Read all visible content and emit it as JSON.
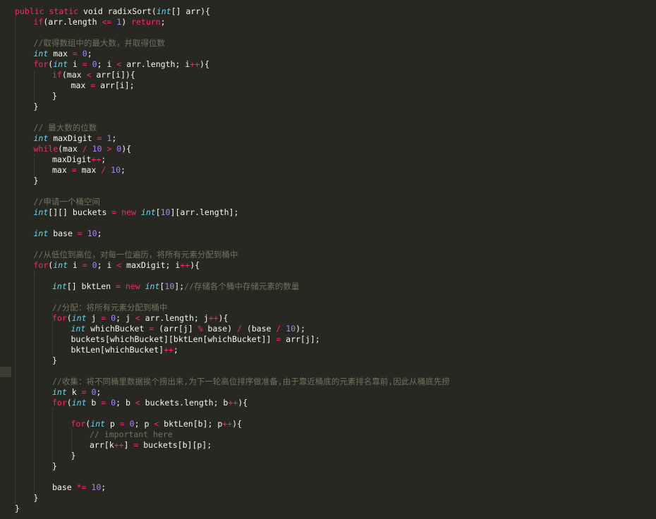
{
  "editor": {
    "lines": [
      {
        "i": 0,
        "t": [
          [
            "kw",
            "public"
          ],
          [
            "pl",
            " "
          ],
          [
            "kw",
            "static"
          ],
          [
            "pl",
            " void radixSort("
          ],
          [
            "type",
            "int"
          ],
          [
            "pl",
            "[] arr){"
          ]
        ]
      },
      {
        "i": 1,
        "t": [
          [
            "kw",
            "if"
          ],
          [
            "pl",
            "(arr.length "
          ],
          [
            "op",
            "<="
          ],
          [
            "pl",
            " "
          ],
          [
            "num",
            "1"
          ],
          [
            "pl",
            ") "
          ],
          [
            "kw",
            "return"
          ],
          [
            "pl",
            ";"
          ]
        ]
      },
      {
        "i": 0,
        "t": []
      },
      {
        "i": 1,
        "t": [
          [
            "com",
            "//取得数组中的最大数，并取得位数"
          ]
        ]
      },
      {
        "i": 1,
        "t": [
          [
            "type",
            "int"
          ],
          [
            "pl",
            " max "
          ],
          [
            "op",
            "="
          ],
          [
            "pl",
            " "
          ],
          [
            "num",
            "0"
          ],
          [
            "pl",
            ";"
          ]
        ]
      },
      {
        "i": 1,
        "t": [
          [
            "kw",
            "for"
          ],
          [
            "pl",
            "("
          ],
          [
            "type",
            "int"
          ],
          [
            "pl",
            " i "
          ],
          [
            "op",
            "="
          ],
          [
            "pl",
            " "
          ],
          [
            "num",
            "0"
          ],
          [
            "pl",
            "; i "
          ],
          [
            "op",
            "<"
          ],
          [
            "pl",
            " arr.length; i"
          ],
          [
            "op",
            "++"
          ],
          [
            "pl",
            "){"
          ]
        ]
      },
      {
        "i": 2,
        "t": [
          [
            "kw",
            "if"
          ],
          [
            "pl",
            "(max "
          ],
          [
            "op",
            "<"
          ],
          [
            "pl",
            " arr[i]){"
          ]
        ]
      },
      {
        "i": 3,
        "t": [
          [
            "pl",
            "max "
          ],
          [
            "op",
            "="
          ],
          [
            "pl",
            " arr[i];"
          ]
        ]
      },
      {
        "i": 2,
        "t": [
          [
            "pl",
            "}"
          ]
        ]
      },
      {
        "i": 1,
        "t": [
          [
            "pl",
            "}"
          ]
        ]
      },
      {
        "i": 0,
        "t": []
      },
      {
        "i": 1,
        "t": [
          [
            "com",
            "// 最大数的位数"
          ]
        ]
      },
      {
        "i": 1,
        "t": [
          [
            "type",
            "int"
          ],
          [
            "pl",
            " maxDigit "
          ],
          [
            "op",
            "="
          ],
          [
            "pl",
            " "
          ],
          [
            "num",
            "1"
          ],
          [
            "pl",
            ";"
          ]
        ]
      },
      {
        "i": 1,
        "t": [
          [
            "kw",
            "while"
          ],
          [
            "pl",
            "(max "
          ],
          [
            "op",
            "/"
          ],
          [
            "pl",
            " "
          ],
          [
            "num",
            "10"
          ],
          [
            "pl",
            " "
          ],
          [
            "op",
            ">"
          ],
          [
            "pl",
            " "
          ],
          [
            "num",
            "0"
          ],
          [
            "pl",
            "){"
          ]
        ]
      },
      {
        "i": 2,
        "t": [
          [
            "pl",
            "maxDigit"
          ],
          [
            "op",
            "++"
          ],
          [
            "pl",
            ";"
          ]
        ]
      },
      {
        "i": 2,
        "t": [
          [
            "pl",
            "max "
          ],
          [
            "op",
            "="
          ],
          [
            "pl",
            " max "
          ],
          [
            "op",
            "/"
          ],
          [
            "pl",
            " "
          ],
          [
            "num",
            "10"
          ],
          [
            "pl",
            ";"
          ]
        ]
      },
      {
        "i": 1,
        "t": [
          [
            "pl",
            "}"
          ]
        ]
      },
      {
        "i": 0,
        "t": []
      },
      {
        "i": 1,
        "t": [
          [
            "com",
            "//申请一个桶空间"
          ]
        ]
      },
      {
        "i": 1,
        "t": [
          [
            "type",
            "int"
          ],
          [
            "pl",
            "[][] buckets "
          ],
          [
            "op",
            "="
          ],
          [
            "pl",
            " "
          ],
          [
            "kw",
            "new"
          ],
          [
            "pl",
            " "
          ],
          [
            "type",
            "int"
          ],
          [
            "pl",
            "["
          ],
          [
            "num",
            "10"
          ],
          [
            "pl",
            "][arr.length];"
          ]
        ]
      },
      {
        "i": 0,
        "t": []
      },
      {
        "i": 1,
        "t": [
          [
            "type",
            "int"
          ],
          [
            "pl",
            " base "
          ],
          [
            "op",
            "="
          ],
          [
            "pl",
            " "
          ],
          [
            "num",
            "10"
          ],
          [
            "pl",
            ";"
          ]
        ]
      },
      {
        "i": 0,
        "t": []
      },
      {
        "i": 1,
        "t": [
          [
            "com",
            "//从低位到高位，对每一位遍历，将所有元素分配到桶中"
          ]
        ]
      },
      {
        "i": 1,
        "t": [
          [
            "kw",
            "for"
          ],
          [
            "pl",
            "("
          ],
          [
            "type",
            "int"
          ],
          [
            "pl",
            " i "
          ],
          [
            "op",
            "="
          ],
          [
            "pl",
            " "
          ],
          [
            "num",
            "0"
          ],
          [
            "pl",
            "; i "
          ],
          [
            "op",
            "<"
          ],
          [
            "pl",
            " maxDigit; i"
          ],
          [
            "op",
            "++"
          ],
          [
            "pl",
            "){"
          ]
        ]
      },
      {
        "i": 0,
        "t": []
      },
      {
        "i": 2,
        "t": [
          [
            "type",
            "int"
          ],
          [
            "pl",
            "[] bktLen "
          ],
          [
            "op",
            "="
          ],
          [
            "pl",
            " "
          ],
          [
            "kw",
            "new"
          ],
          [
            "pl",
            " "
          ],
          [
            "type",
            "int"
          ],
          [
            "pl",
            "["
          ],
          [
            "num",
            "10"
          ],
          [
            "pl",
            "];"
          ],
          [
            "com",
            "//存储各个桶中存储元素的数量"
          ]
        ]
      },
      {
        "i": 0,
        "t": []
      },
      {
        "i": 2,
        "t": [
          [
            "com",
            "//分配：将所有元素分配到桶中"
          ]
        ]
      },
      {
        "i": 2,
        "t": [
          [
            "kw",
            "for"
          ],
          [
            "pl",
            "("
          ],
          [
            "type",
            "int"
          ],
          [
            "pl",
            " j "
          ],
          [
            "op",
            "="
          ],
          [
            "pl",
            " "
          ],
          [
            "num",
            "0"
          ],
          [
            "pl",
            "; j "
          ],
          [
            "op",
            "<"
          ],
          [
            "pl",
            " arr.length; j"
          ],
          [
            "op",
            "++"
          ],
          [
            "pl",
            "){"
          ]
        ]
      },
      {
        "i": 3,
        "t": [
          [
            "type",
            "int"
          ],
          [
            "pl",
            " whichBucket "
          ],
          [
            "op",
            "="
          ],
          [
            "pl",
            " (arr[j] "
          ],
          [
            "op",
            "%"
          ],
          [
            "pl",
            " base) "
          ],
          [
            "op",
            "/"
          ],
          [
            "pl",
            " (base "
          ],
          [
            "op",
            "/"
          ],
          [
            "pl",
            " "
          ],
          [
            "num",
            "10"
          ],
          [
            "pl",
            ");"
          ]
        ]
      },
      {
        "i": 3,
        "t": [
          [
            "pl",
            "buckets[whichBucket][bktLen[whichBucket]] "
          ],
          [
            "op",
            "="
          ],
          [
            "pl",
            " arr[j];"
          ]
        ]
      },
      {
        "i": 3,
        "t": [
          [
            "pl",
            "bktLen[whichBucket]"
          ],
          [
            "op",
            "++"
          ],
          [
            "pl",
            ";"
          ]
        ]
      },
      {
        "i": 2,
        "t": [
          [
            "pl",
            "}"
          ]
        ]
      },
      {
        "i": 0,
        "t": []
      },
      {
        "i": 2,
        "t": [
          [
            "com",
            "//收集：将不同桶里数据挨个捞出来,为下一轮高位排序做准备,由于靠近桶底的元素排名靠前,因此从桶底先捞"
          ]
        ]
      },
      {
        "i": 2,
        "t": [
          [
            "type",
            "int"
          ],
          [
            "pl",
            " k "
          ],
          [
            "op",
            "="
          ],
          [
            "pl",
            " "
          ],
          [
            "num",
            "0"
          ],
          [
            "pl",
            ";"
          ]
        ]
      },
      {
        "i": 2,
        "t": [
          [
            "kw",
            "for"
          ],
          [
            "pl",
            "("
          ],
          [
            "type",
            "int"
          ],
          [
            "pl",
            " b "
          ],
          [
            "op",
            "="
          ],
          [
            "pl",
            " "
          ],
          [
            "num",
            "0"
          ],
          [
            "pl",
            "; b "
          ],
          [
            "op",
            "<"
          ],
          [
            "pl",
            " buckets.length; b"
          ],
          [
            "op",
            "++"
          ],
          [
            "pl",
            "){"
          ]
        ]
      },
      {
        "i": 0,
        "t": []
      },
      {
        "i": 3,
        "t": [
          [
            "kw",
            "for"
          ],
          [
            "pl",
            "("
          ],
          [
            "type",
            "int"
          ],
          [
            "pl",
            " p "
          ],
          [
            "op",
            "="
          ],
          [
            "pl",
            " "
          ],
          [
            "num",
            "0"
          ],
          [
            "pl",
            "; p "
          ],
          [
            "op",
            "<"
          ],
          [
            "pl",
            " bktLen[b]; p"
          ],
          [
            "op",
            "++"
          ],
          [
            "pl",
            "){"
          ]
        ]
      },
      {
        "i": 4,
        "t": [
          [
            "com",
            "// important here"
          ]
        ]
      },
      {
        "i": 4,
        "t": [
          [
            "pl",
            "arr[k"
          ],
          [
            "op",
            "++"
          ],
          [
            "pl",
            "] "
          ],
          [
            "op",
            "="
          ],
          [
            "pl",
            " buckets[b][p];"
          ]
        ]
      },
      {
        "i": 3,
        "t": [
          [
            "pl",
            "}"
          ]
        ]
      },
      {
        "i": 2,
        "t": [
          [
            "pl",
            "}"
          ]
        ]
      },
      {
        "i": 0,
        "t": []
      },
      {
        "i": 2,
        "t": [
          [
            "pl",
            "base "
          ],
          [
            "op",
            "*="
          ],
          [
            "pl",
            " "
          ],
          [
            "num",
            "10"
          ],
          [
            "pl",
            ";"
          ]
        ]
      },
      {
        "i": 1,
        "t": [
          [
            "pl",
            "}"
          ]
        ]
      },
      {
        "i": 0,
        "t": [
          [
            "pl",
            "}"
          ]
        ]
      }
    ]
  }
}
